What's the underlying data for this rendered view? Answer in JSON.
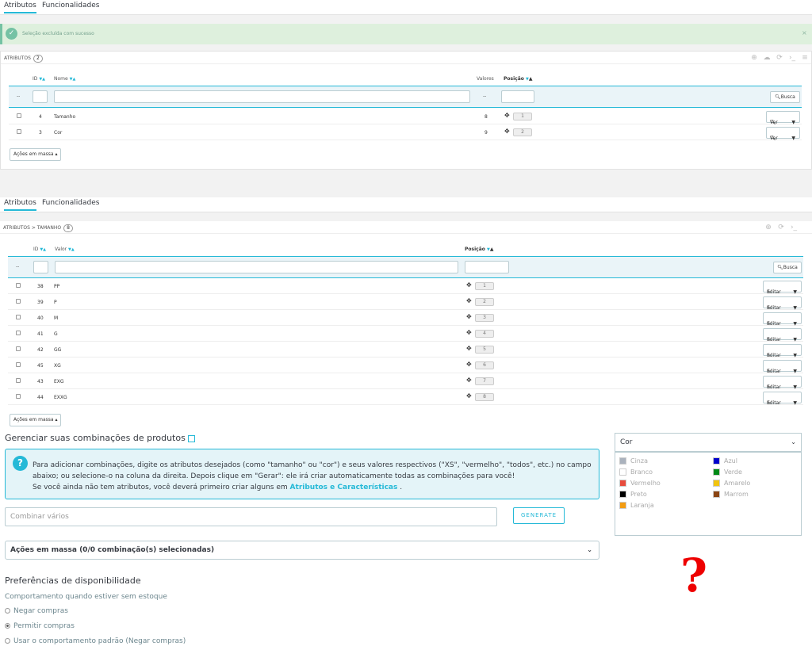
{
  "tabs1": {
    "attributes": "Atributos",
    "features": "Funcionalidades"
  },
  "alert": {
    "text": "Seleção excluída com sucesso",
    "close": "×"
  },
  "panel1": {
    "title": "Atributos",
    "count": "2",
    "headers": {
      "id": "ID",
      "name": "Nome",
      "values": "Valores",
      "position": "Posição"
    },
    "filter_dash": "--",
    "filter_dash2": "--",
    "search": "Busca",
    "rows": [
      {
        "id": "4",
        "name": "Tamanho",
        "values": "8",
        "pos": "1",
        "btn": "Ver"
      },
      {
        "id": "3",
        "name": "Cor",
        "values": "9",
        "pos": "2",
        "btn": "Ver"
      }
    ],
    "bulk": "Ações em massa"
  },
  "tabs2": {
    "attributes": "Atributos",
    "features": "Funcionalidades"
  },
  "panel2": {
    "title": "Atributos > Tamanho",
    "count": "8",
    "headers": {
      "id": "ID",
      "value": "Valor",
      "position": "Posição"
    },
    "filter_dash": "--",
    "search": "Busca",
    "rows": [
      {
        "id": "38",
        "value": "PP",
        "pos": "1",
        "btn": "Editar"
      },
      {
        "id": "39",
        "value": "P",
        "pos": "2",
        "btn": "Editar"
      },
      {
        "id": "40",
        "value": "M",
        "pos": "3",
        "btn": "Editar"
      },
      {
        "id": "41",
        "value": "G",
        "pos": "4",
        "btn": "Editar"
      },
      {
        "id": "42",
        "value": "GG",
        "pos": "5",
        "btn": "Editar"
      },
      {
        "id": "45",
        "value": "XG",
        "pos": "6",
        "btn": "Editar"
      },
      {
        "id": "43",
        "value": "EXG",
        "pos": "7",
        "btn": "Editar"
      },
      {
        "id": "44",
        "value": "EXXG",
        "pos": "8",
        "btn": "Editar"
      }
    ],
    "bulk": "Ações em massa"
  },
  "combos": {
    "title": "Gerenciar suas combinações de produtos",
    "info1": "Para adicionar combinações, digite os atributos desejados (como \"tamanho\" ou \"cor\") e seus valores respectivos (\"XS\", \"vermelho\", \"todos\", etc.) no campo",
    "info2": "abaixo; ou selecione-o na coluna da direita. Depois clique em \"Gerar\": ele irá criar automaticamente todas as combinações para você!",
    "info3": "Se você ainda não tem atributos, você deverá primeiro criar alguns em",
    "info_link": "Atributos e Características",
    "info_end": ".",
    "combine_placeholder": "Combinar vários",
    "generate": "GENERATE",
    "bulk_actions": "Ações em massa (0/0 combinação(s) selecionadas)"
  },
  "availability": {
    "title": "Preferências de disponibilidade",
    "subtitle": "Comportamento quando estiver sem estoque",
    "options": [
      "Negar compras",
      "Permitir compras",
      "Usar o comportamento padrão (Negar compras)"
    ],
    "selected": 1
  },
  "colorbox": {
    "select": "Cor",
    "colors": [
      {
        "name": "Cinza",
        "color": "#aab2bd"
      },
      {
        "name": "Azul",
        "color": "#0000cc"
      },
      {
        "name": "Branco",
        "color": "#ffffff"
      },
      {
        "name": "Verde",
        "color": "#008a17"
      },
      {
        "name": "Vermelho",
        "color": "#e84c3d"
      },
      {
        "name": "Amarelo",
        "color": "#f1c40f"
      },
      {
        "name": "Preto",
        "color": "#000000"
      },
      {
        "name": "Marrom",
        "color": "#8b4513"
      },
      {
        "name": "Laranja",
        "color": "#f39c11"
      }
    ]
  },
  "question": "?"
}
